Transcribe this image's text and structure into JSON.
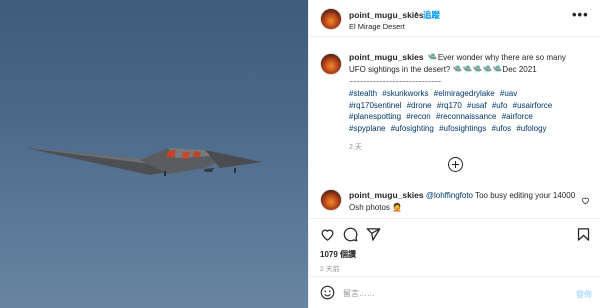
{
  "post": {
    "username": "point_mugu_skies",
    "separator_dot": "•",
    "follow_label": "追蹤",
    "location": "El Mirage Desert",
    "more_label": "•••"
  },
  "caption": {
    "username": "point_mugu_skies",
    "text": "🛸Ever wonder why there are so many UFO sightings in the desert? 🛸🛸🛸🛸🛸Dec 2021",
    "separator": "................................................................",
    "hashtags": [
      "#stealth",
      "#skunkworks",
      "#elmiragedrylake",
      "#uav",
      "#rq170sentinel",
      "#drone",
      "#rq170",
      "#usaf",
      "#ufo",
      "#usairforce",
      "#planespotting",
      "#recon",
      "#reconnaissance",
      "#airforce",
      "#spyplane",
      "#ufosighting",
      "#ufosightings",
      "#ufos",
      "#ufology"
    ],
    "time": "2 天"
  },
  "comment": {
    "username": "point_mugu_skies",
    "mention": "@lohffingfoto",
    "text": " Too busy editing your 14000 Osh photos 🤦"
  },
  "actions": {
    "likes": "1079 個讚",
    "time": "2 天前"
  },
  "add_comment": {
    "placeholder": "留言……",
    "post_label": "發佈"
  },
  "icons": {
    "like": "heart-icon",
    "comment": "comment-bubble-icon",
    "share": "paper-plane-icon",
    "save": "bookmark-icon",
    "emoji": "smiley-icon",
    "comment_like": "heart-icon",
    "load_more": "plus-circle-icon"
  },
  "colors": {
    "link": "#00376b",
    "follow": "#0095f6",
    "post_disabled": "#b2dffc",
    "secondary_text": "#8e8e8e"
  }
}
